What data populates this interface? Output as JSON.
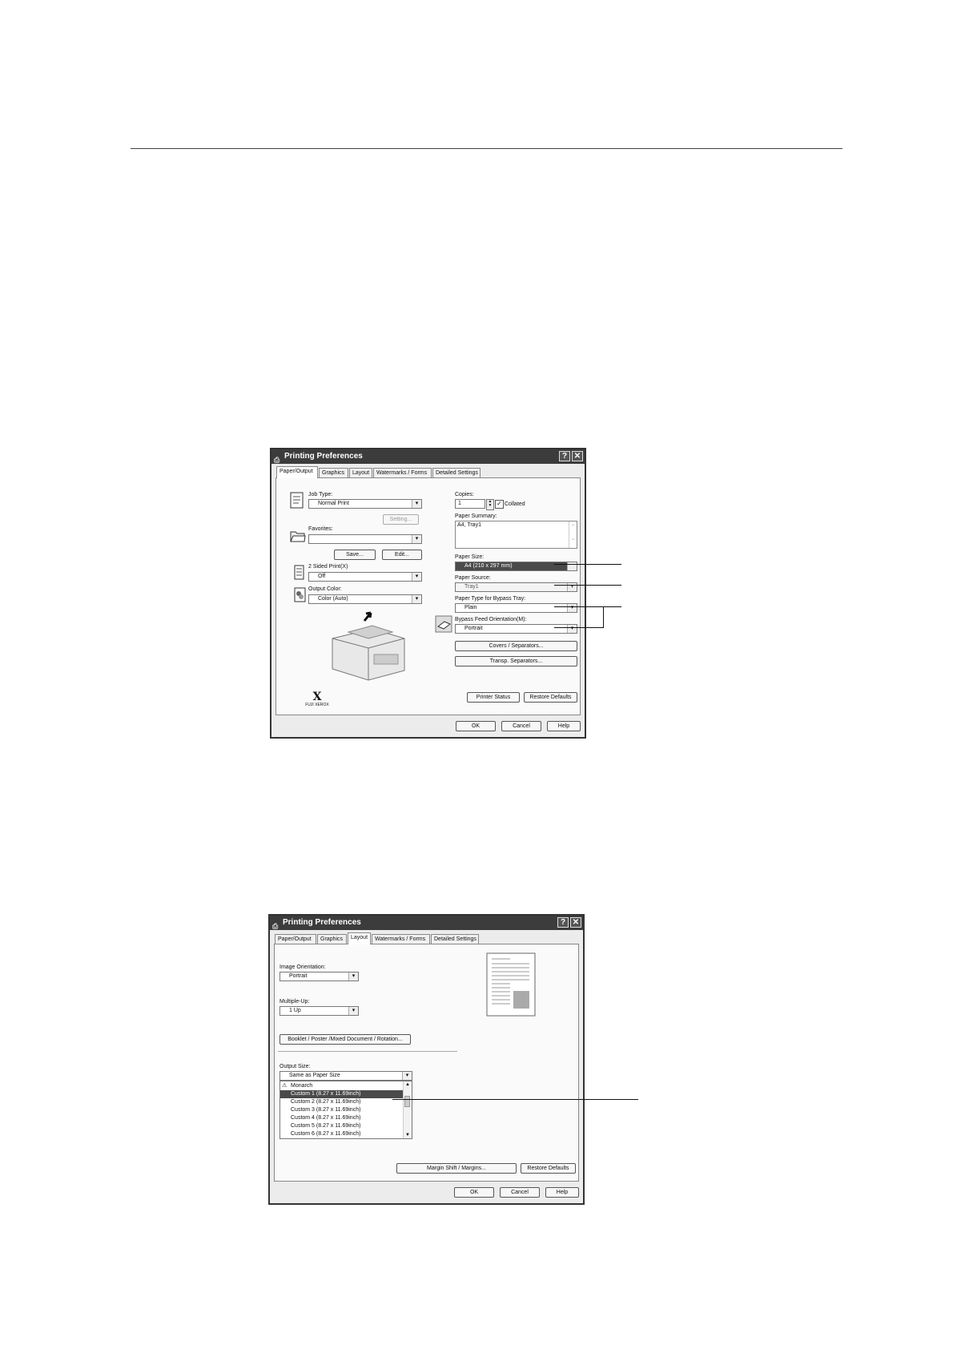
{
  "dialog1": {
    "title": "Printing Preferences",
    "help_btn": "?",
    "close_btn": "✕",
    "tabs": [
      "Paper/Output",
      "Graphics",
      "Layout",
      "Watermarks / Forms",
      "Detailed Settings"
    ],
    "active_tab": "Paper/Output",
    "job_type": {
      "label": "Job Type:",
      "value": "Normal Print"
    },
    "setting_button": "Setting...",
    "favorites": {
      "label": "Favorites:",
      "value": ""
    },
    "save_button": "Save...",
    "edit_button": "Edit...",
    "two_sided": {
      "label": "2 Sided Print(X)",
      "value": "Off"
    },
    "output_color": {
      "label": "Output Color:",
      "value": "Color (Auto)"
    },
    "logo_text": "FUJI XEROX",
    "copies": {
      "label": "Copies:",
      "value": "1",
      "collated_label": "Collated",
      "collated_checked": true
    },
    "paper_summary": {
      "label": "Paper Summary:",
      "value": "A4, Tray1"
    },
    "paper_size": {
      "label": "Paper Size:",
      "value": "A4 (210 x 297 mm)"
    },
    "paper_source": {
      "label": "Paper Source:",
      "value": "Tray1"
    },
    "paper_type_bypass": {
      "label": "Paper Type for Bypass Tray:",
      "value": "Plain"
    },
    "bypass_feed_orientation": {
      "label": "Bypass Feed Orientation(M):",
      "value": "Portrait"
    },
    "covers_button": "Covers / Separators...",
    "transp_button": "Transp. Separators...",
    "printer_status_button": "Printer Status",
    "restore_defaults_button": "Restore Defaults",
    "ok_button": "OK",
    "cancel_button": "Cancel",
    "help_button": "Help"
  },
  "dialog2": {
    "title": "Printing Preferences",
    "help_btn": "?",
    "close_btn": "✕",
    "tabs": [
      "Paper/Output",
      "Graphics",
      "Layout",
      "Watermarks / Forms",
      "Detailed Settings"
    ],
    "active_tab": "Layout",
    "image_orientation": {
      "label": "Image Orientation:",
      "value": "Portrait"
    },
    "multiple_up": {
      "label": "Multiple-Up:",
      "value": "1 Up"
    },
    "booklet_button": "Booklet / Poster /Mixed Document / Rotation...",
    "output_size": {
      "label": "Output Size:",
      "value": "Same as Paper Size"
    },
    "output_size_list": [
      "Monarch",
      "Custom 1 (8.27 x 11.69inch)",
      "Custom 2 (8.27 x 11.69inch)",
      "Custom 3 (8.27 x 11.69inch)",
      "Custom 4 (8.27 x 11.69inch)",
      "Custom 5 (8.27 x 11.69inch)",
      "Custom 6 (8.27 x 11.69inch)"
    ],
    "highlighted_item": "Custom 1 (8.27 x 11.69inch)",
    "margin_shift_button": "Margin Shift / Margins...",
    "restore_defaults_button": "Restore Defaults",
    "ok_button": "OK",
    "cancel_button": "Cancel",
    "help_button": "Help"
  },
  "colors": {
    "titlebar": "#3c3c3c",
    "highlight": "#4a4a4a",
    "dialog_bg": "#ececec"
  }
}
